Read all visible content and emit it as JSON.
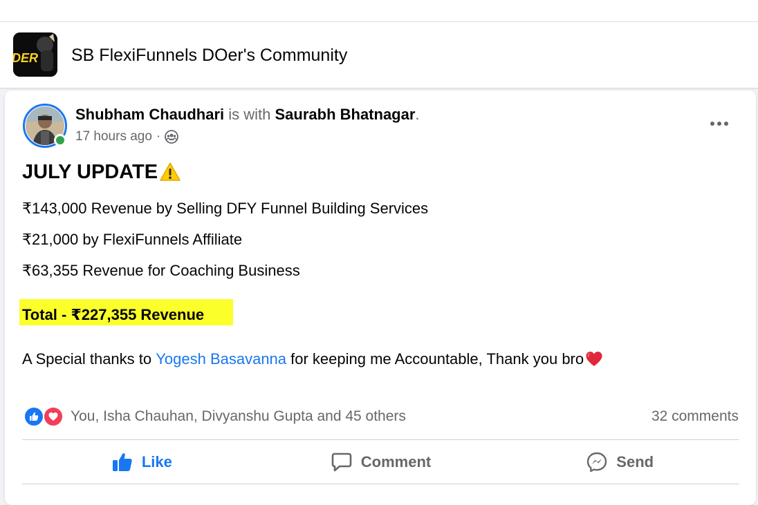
{
  "group": {
    "name": "SB FlexiFunnels DOer's Community",
    "logo_text": "DER"
  },
  "post": {
    "author": "Shubham Chaudhari",
    "with_text": " is with ",
    "tagged": "Saurabh Bhatnagar",
    "tagged_suffix": ".",
    "time": "17 hours ago",
    "separator": "·",
    "audience_icon": "group-members-icon",
    "headline": "JULY UPDATE",
    "headline_emoji": "warning-icon",
    "lines": [
      "₹143,000 Revenue by Selling DFY Funnel Building Services",
      "₹21,000 by FlexiFunnels Affiliate",
      "₹63,355 Revenue for Coaching Business"
    ],
    "total": "Total - ₹227,355 Revenue",
    "thanks_prefix": "A Special thanks to ",
    "mention": "Yogesh Basavanna",
    "thanks_suffix": " for keeping me Accountable, Thank you bro",
    "thanks_emoji": "red-heart-icon"
  },
  "engagement": {
    "reactions_text": "You, Isha Chauhan, Divyanshu Gupta and 45 others",
    "comments_count": "32 comments"
  },
  "actions": {
    "like": "Like",
    "comment": "Comment",
    "send": "Send"
  },
  "colors": {
    "accent": "#1877f2",
    "highlight": "#fbff2a",
    "online": "#31a24c",
    "love": "#f33e58"
  }
}
